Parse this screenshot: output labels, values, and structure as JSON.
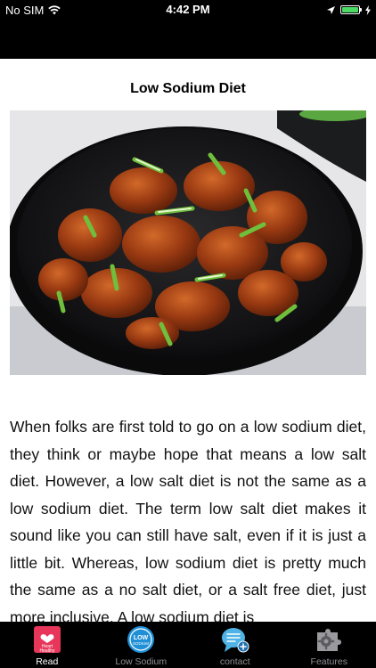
{
  "status_bar": {
    "carrier": "No SIM",
    "time": "4:42 PM"
  },
  "article": {
    "title": "Low Sodium Diet",
    "body": "When folks are first told to go on a low sodium diet, they think or maybe hope that means a low salt diet. However, a low salt diet is not the same as a low sodium diet. The term low salt diet makes it sound like you can still have salt, even if it is just a little bit. Whereas, low sodium diet is pretty much the same as a no salt diet, or a salt free diet, just more inclusive. A low sodium diet is"
  },
  "tab_bar": {
    "tabs": [
      {
        "label": "Read",
        "icon": "heart-healthy-icon",
        "icon_text_1": "Heart",
        "icon_text_2": "Healthy",
        "active": true
      },
      {
        "label": "Low Sodium",
        "icon": "low-sodium-badge-icon",
        "icon_text_1": "LOW",
        "icon_text_2": "SODIUM",
        "active": false
      },
      {
        "label": "contact",
        "icon": "chat-plus-icon",
        "active": false
      },
      {
        "label": "Features",
        "icon": "puzzle-gear-icon",
        "active": false
      }
    ]
  },
  "colors": {
    "status_bar": "#000000",
    "battery_fill": "#4cd964",
    "read_icon": "#e8365a",
    "low_sodium_icon": "#1f8fd6",
    "contact_icon": "#4fb3e6",
    "tab_label_inactive": "#8e8e93"
  }
}
